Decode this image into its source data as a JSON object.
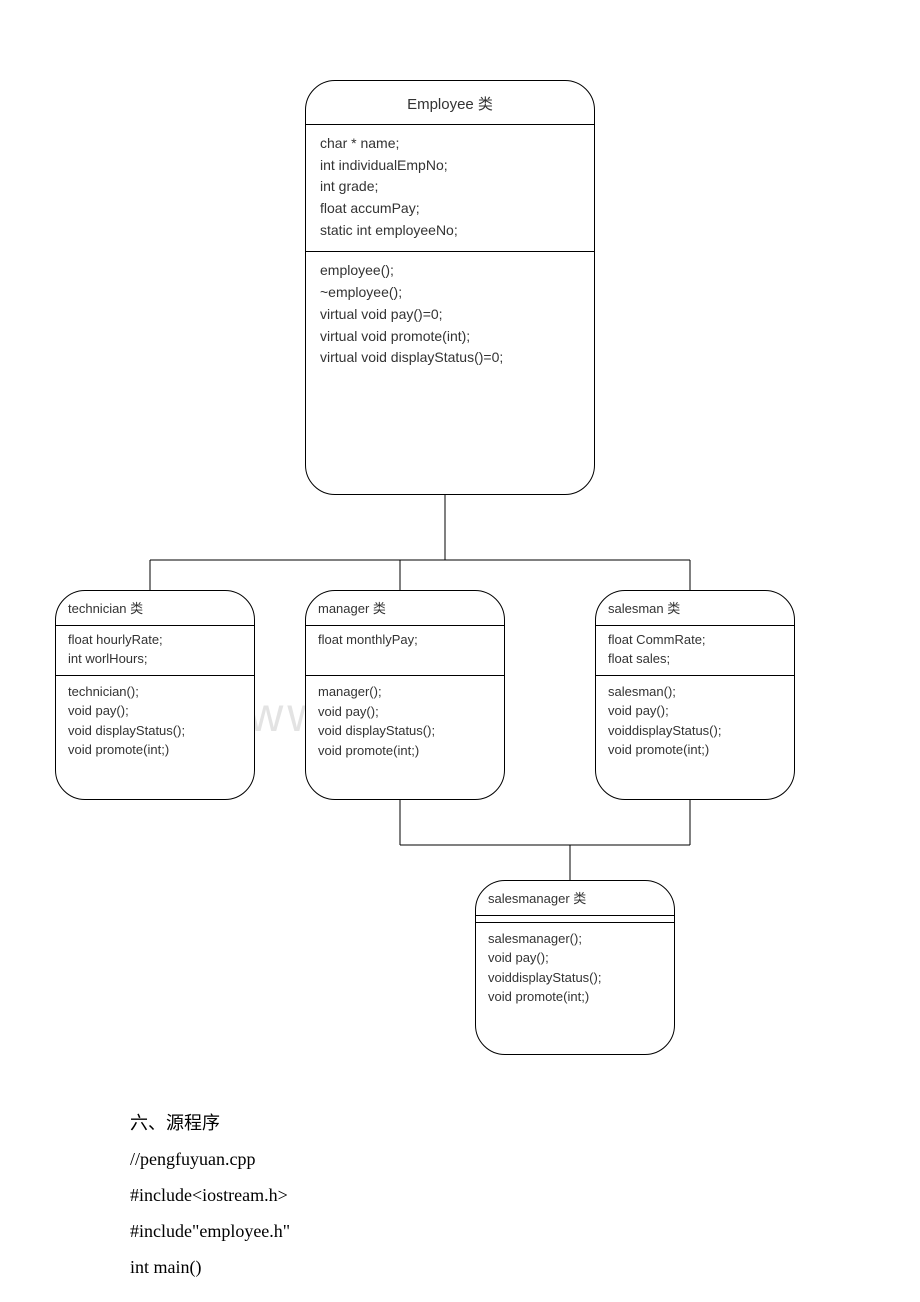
{
  "chart_data": {
    "type": "diagram",
    "title": "UML Class Inheritance Diagram",
    "nodes": [
      {
        "id": "employee",
        "name": "Employee 类",
        "attributes": [
          "char * name;",
          "int individualEmpNo;",
          "int grade;",
          "float accumPay;",
          "static int employeeNo;"
        ],
        "methods": [
          "employee();",
          "~employee();",
          "virtual void pay()=0;",
          "virtual void promote(int);",
          "virtual void displayStatus()=0;"
        ]
      },
      {
        "id": "technician",
        "name": "technician 类",
        "attributes": [
          "float hourlyRate;",
          "int worlHours;"
        ],
        "methods": [
          "technician();",
          "void pay();",
          "void displayStatus();",
          "void promote(int;)"
        ]
      },
      {
        "id": "manager",
        "name": "manager 类",
        "attributes": [
          "float monthlyPay;"
        ],
        "methods": [
          "manager();",
          "void pay();",
          "void displayStatus();",
          "void promote(int;)"
        ]
      },
      {
        "id": "salesman",
        "name": "salesman 类",
        "attributes": [
          "float CommRate;",
          "float sales;"
        ],
        "methods": [
          "salesman();",
          "void pay();",
          "voiddisplayStatus();",
          "void promote(int;)"
        ]
      },
      {
        "id": "salesmanager",
        "name": "salesmanager 类",
        "attributes": [],
        "methods": [
          "salesmanager();",
          "void pay();",
          "voiddisplayStatus();",
          "void promote(int;)"
        ]
      }
    ],
    "edges": [
      {
        "from": "employee",
        "to": "technician"
      },
      {
        "from": "employee",
        "to": "manager"
      },
      {
        "from": "employee",
        "to": "salesman"
      },
      {
        "from": "manager",
        "to": "salesmanager"
      },
      {
        "from": "salesman",
        "to": "salesmanager"
      }
    ]
  },
  "source": {
    "heading": "六、源程序",
    "lines": [
      " //pengfuyuan.cpp",
      "#include<iostream.h>",
      "#include\"employee.h\"",
      "int main()"
    ]
  },
  "watermark": "www.         .c"
}
